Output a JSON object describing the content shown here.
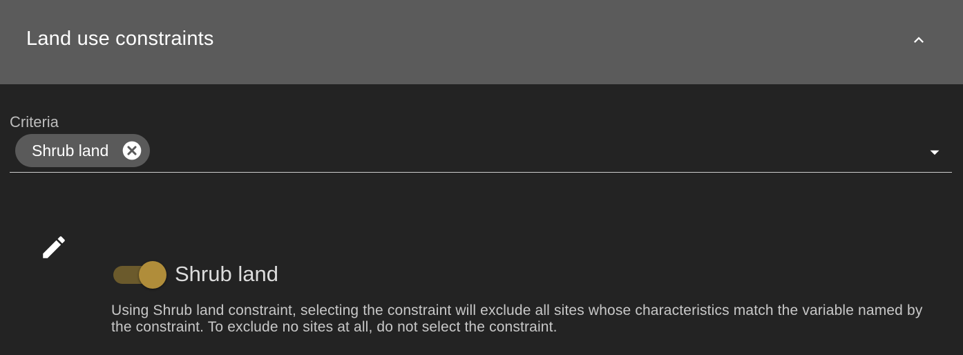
{
  "panel": {
    "title": "Land use constraints",
    "expanded": true
  },
  "criteria": {
    "label": "Criteria",
    "selected_chip": "Shrub land"
  },
  "constraint": {
    "toggle_on": true,
    "label": "Shrub land",
    "description": "Using Shrub land constraint, selecting the constraint will exclude all sites whose characteristics match the variable named by the constraint. To exclude no sites at all, do not select the constraint."
  },
  "colors": {
    "header_bg": "#5b5b5b",
    "body_bg": "#232323",
    "accent": "#b08d3a",
    "chip_bg": "#5a5a5a"
  },
  "icons": {
    "collapse": "chevron-up-icon",
    "chip_delete": "cancel-circle-icon",
    "dropdown": "arrow-drop-down-icon",
    "edit": "pencil-icon"
  }
}
